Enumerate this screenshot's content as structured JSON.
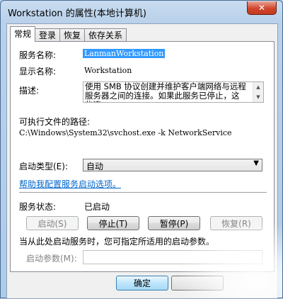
{
  "window": {
    "title": "Workstation 的属性(本地计算机)",
    "close_label": "✕"
  },
  "tabs": [
    {
      "label": "常规",
      "active": true
    },
    {
      "label": "登录",
      "active": false
    },
    {
      "label": "恢复",
      "active": false
    },
    {
      "label": "依存关系",
      "active": false
    }
  ],
  "general": {
    "service_name_label": "服务名称:",
    "service_name_value": "LanmanWorkstation",
    "display_name_label": "显示名称:",
    "display_name_value": "Workstation",
    "description_label": "描述:",
    "description_value": "使用 SMB 协议创建并维护客户端网络与远程服务器之间的连接。如果此服务已停止，这些连",
    "exe_path_label": "可执行文件的路径:",
    "exe_path_value": "C:\\Windows\\System32\\svchost.exe -k NetworkService",
    "startup_type_label": "启动类型(E):",
    "startup_type_value": "自动",
    "help_link": "帮助我配置服务启动选项。",
    "status_label": "服务状态:",
    "status_value": "已启动",
    "start_params_hint": "当从此处启动服务时，您可指定所适用的启动参数。",
    "start_params_label": "启动参数(M):",
    "start_params_value": ""
  },
  "buttons": {
    "start": {
      "label": "启动(S)",
      "enabled": false
    },
    "stop": {
      "label": "停止(T)",
      "enabled": true
    },
    "pause": {
      "label": "暂停(P)",
      "enabled": true
    },
    "resume": {
      "label": "恢复(R)",
      "enabled": false
    }
  },
  "footer": {
    "ok_label": "确定",
    "cancel_label": ""
  }
}
